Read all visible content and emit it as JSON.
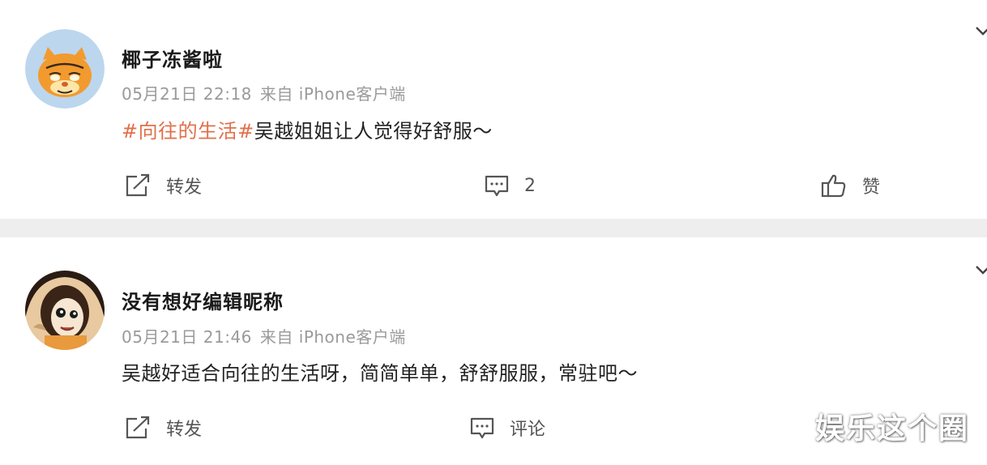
{
  "posts": [
    {
      "username": "椰子冻酱啦",
      "date": "05月21日 22:18",
      "source": "来自 iPhone客户端",
      "hashtag": "#向往的生活#",
      "text": "吴越姐姐让人觉得好舒服～",
      "repost_label": "转发",
      "comment_label": "2",
      "like_label": "赞",
      "avatar_icon": "cartoon-cat-avatar"
    },
    {
      "username": "没有想好编辑昵称",
      "date": "05月21日 21:46",
      "source": "来自 iPhone客户端",
      "hashtag": "",
      "text": "吴越好适合向往的生活呀，简简单单，舒舒服服，常驻吧～",
      "repost_label": "转发",
      "comment_label": "评论",
      "avatar_icon": "cartoon-character-avatar"
    }
  ],
  "watermark": "娱乐这个圈",
  "colors": {
    "hashtag": "#e0704a",
    "meta_text": "#9a9a9a",
    "background": "#f3f3f5"
  }
}
